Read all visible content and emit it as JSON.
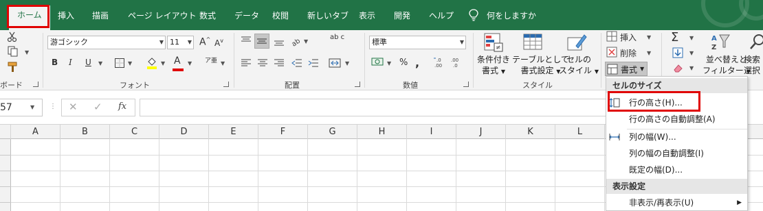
{
  "tabs": [
    {
      "label": "ホーム",
      "active": true
    },
    {
      "label": "挿入"
    },
    {
      "label": "描画"
    },
    {
      "label": "ページ レイアウト"
    },
    {
      "label": "数式"
    },
    {
      "label": "データ"
    },
    {
      "label": "校閲"
    },
    {
      "label": "新しいタブ"
    },
    {
      "label": "表示"
    },
    {
      "label": "開発"
    },
    {
      "label": "ヘルプ"
    }
  ],
  "tell_me": "何をしますか",
  "colors": {
    "excel_green": "#217346",
    "highlight_red": "#e00000"
  },
  "ribbon": {
    "clipboard": {
      "label": "ボード"
    },
    "font": {
      "name": "游ゴシック",
      "size": "11",
      "label": "フォント",
      "bold": "B",
      "italic": "I",
      "underline": "U",
      "grow": "A",
      "shrink": "A",
      "font_color_letter": "A",
      "ruby": "ア亜"
    },
    "alignment": {
      "label": "配置",
      "wrap": "ab c"
    },
    "number": {
      "format": "標準",
      "label": "数値",
      "percent": "%",
      "comma": ","
    },
    "styles": {
      "label": "スタイル",
      "conditional": [
        "条件付き",
        "書式"
      ],
      "table": [
        "テーブルとして",
        "書式設定"
      ],
      "cell_styles": [
        "セルの",
        "スタイル"
      ]
    },
    "cells": {
      "insert": "挿入",
      "delete": "削除",
      "format": "書式"
    },
    "editing": {
      "sort_filter": [
        "並べ替えと",
        "フィルター"
      ],
      "find_select": [
        "検索",
        "選択"
      ]
    }
  },
  "formula_bar": {
    "name_box": "57",
    "fx": "fx"
  },
  "columns": [
    "A",
    "B",
    "C",
    "D",
    "E",
    "F",
    "G",
    "H",
    "I",
    "J",
    "K",
    "L"
  ],
  "menu": {
    "section1": "セルのサイズ",
    "items1": [
      {
        "label": "行の高さ(H)...",
        "icon": "row-height-icon"
      },
      {
        "label": "行の高さの自動調整(A)"
      },
      {
        "label": "列の幅(W)...",
        "icon": "column-width-icon"
      },
      {
        "label": "列の幅の自動調整(I)"
      },
      {
        "label": "既定の幅(D)..."
      }
    ],
    "section2": "表示設定",
    "items2": [
      {
        "label": "非表示/再表示(U)",
        "submenu": true
      }
    ]
  }
}
